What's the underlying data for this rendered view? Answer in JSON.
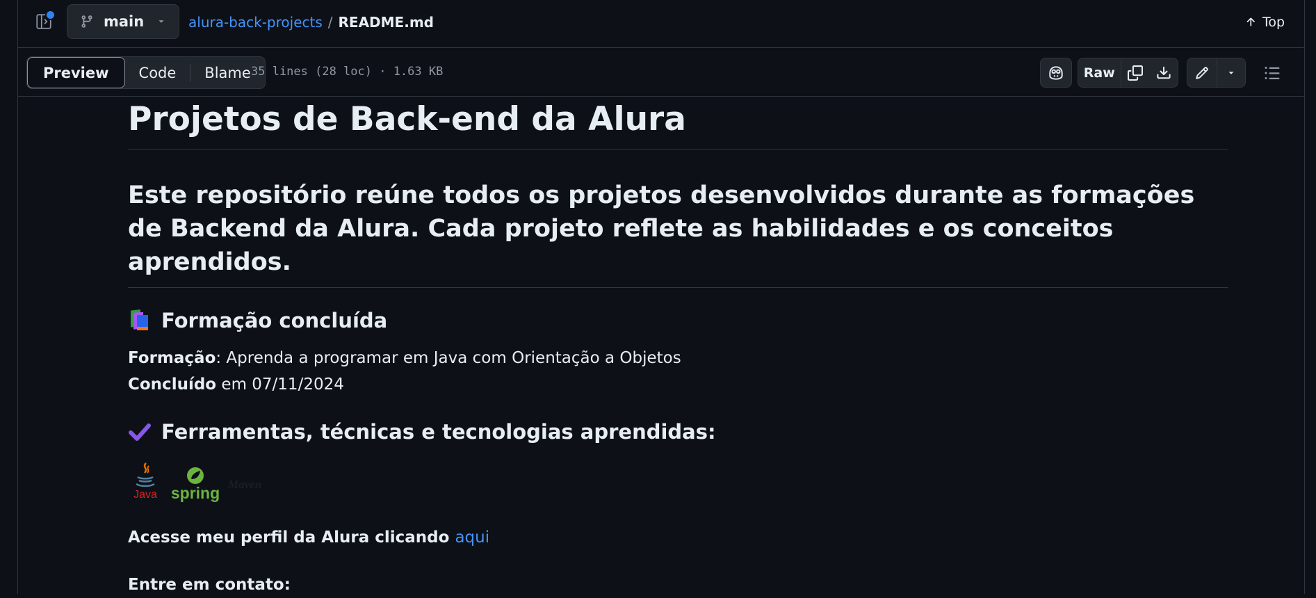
{
  "header": {
    "branch": "main",
    "repo": "alura-back-projects",
    "separator": "/",
    "file": "README.md",
    "top_label": "Top"
  },
  "toolbar": {
    "tabs": [
      "Preview",
      "Code",
      "Blame"
    ],
    "active_tab": "Preview",
    "file_info": "35 lines (28 loc) · 1.63 KB",
    "raw_label": "Raw"
  },
  "readme": {
    "title": "Projetos de Back-end da Alura",
    "subtitle": "Este repositório reúne todos os projetos desenvolvidos durante as formações de Backend da Alura. Cada projeto reflete as habilidades e os conceitos aprendidos.",
    "section1_heading": "Formação concluída",
    "formacao_label": "Formação",
    "formacao_value": ": Aprenda a programar em Java com Orientação a Objetos",
    "concluido_label": "Concluído",
    "concluido_value": " em 07/11/2024",
    "section2_heading": "Ferramentas, técnicas e tecnologias aprendidas:",
    "logos": [
      "Java",
      "spring",
      "Maven"
    ],
    "profile_text": "Acesse meu perfil da Alura clicando ",
    "profile_link": "aqui",
    "contact_heading": "Entre em contato:"
  },
  "colors": {
    "background": "#0d1117",
    "link": "#4493f8",
    "border": "#30363d",
    "notification_dot": "#2f81f7"
  }
}
